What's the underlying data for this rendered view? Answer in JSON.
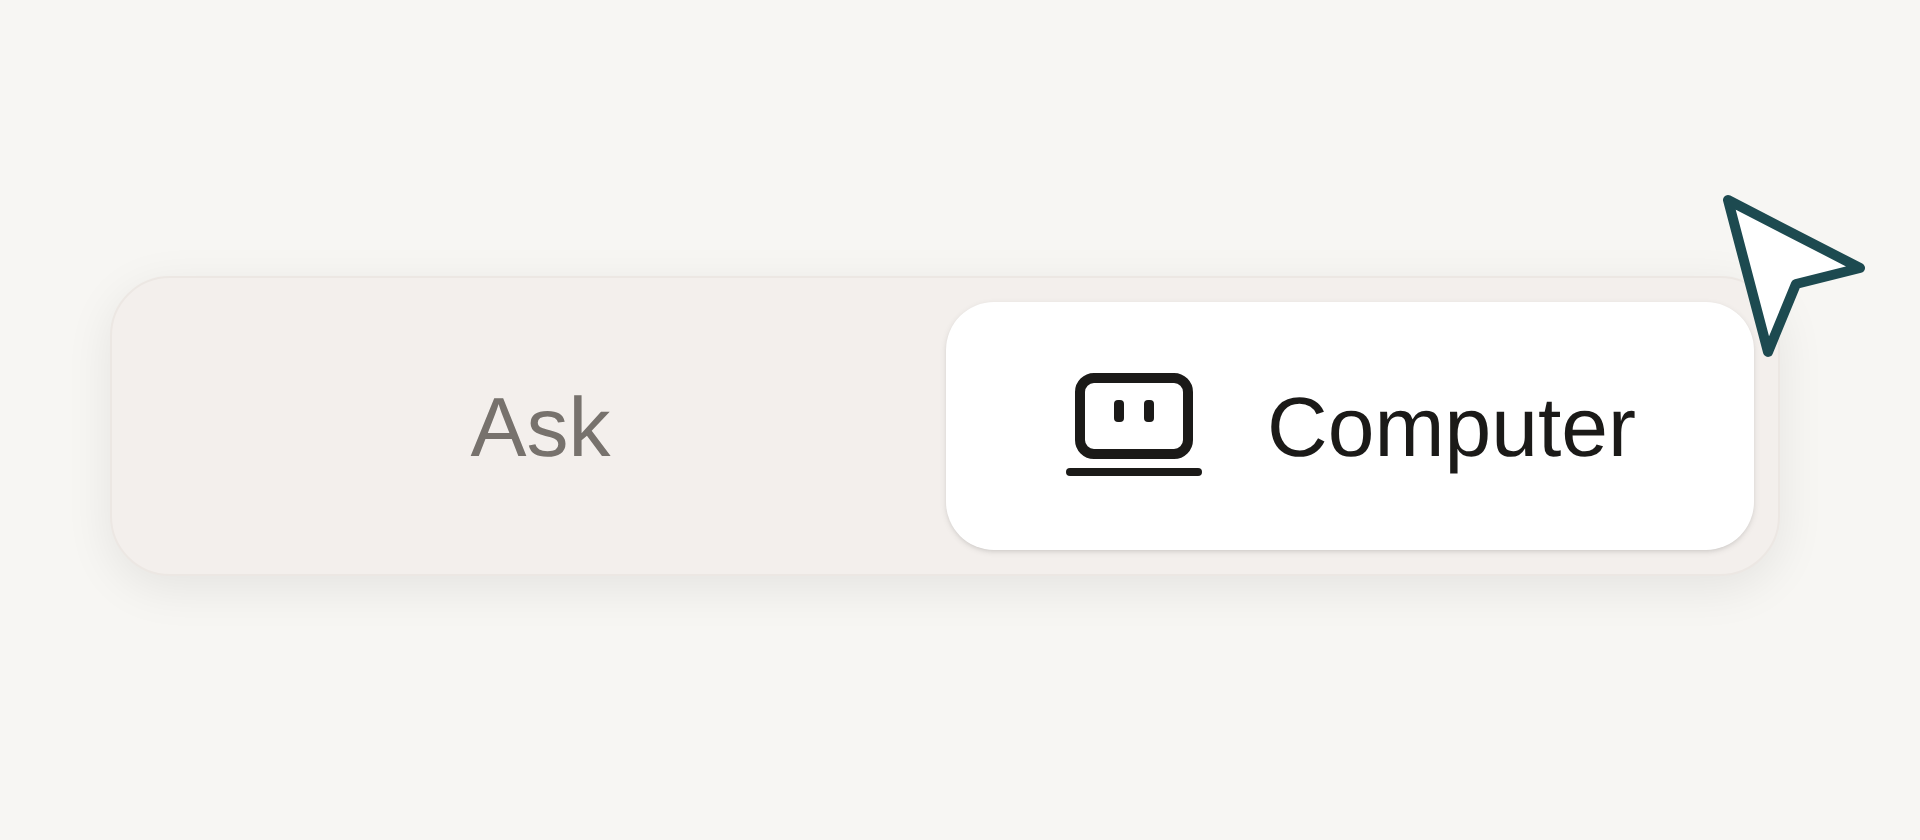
{
  "mode_switch": {
    "tabs": [
      {
        "label": "Ask",
        "selected": false,
        "kind": "plain"
      },
      {
        "label": "Computer",
        "selected": true,
        "kind": "with-icon"
      }
    ]
  }
}
